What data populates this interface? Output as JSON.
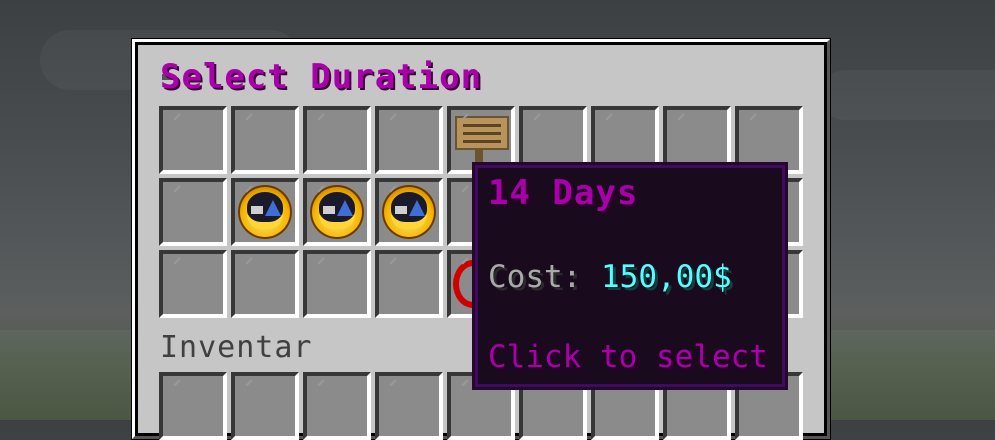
{
  "window": {
    "title": "Select Duration",
    "inventory_label": "Inventar"
  },
  "tooltip": {
    "title": "14 Days",
    "cost_label": "Cost:",
    "cost_value": "150,00$",
    "action": "Click to select"
  },
  "slots": {
    "rows": 4,
    "cols": 9,
    "items": [
      {
        "row": 0,
        "col": 4,
        "icon": "sign-icon"
      },
      {
        "row": 1,
        "col": 1,
        "icon": "clock-icon"
      },
      {
        "row": 1,
        "col": 2,
        "icon": "clock-icon"
      },
      {
        "row": 1,
        "col": 3,
        "icon": "clock-icon"
      },
      {
        "row": 2,
        "col": 4,
        "icon": "barrier-icon"
      }
    ]
  },
  "colors": {
    "title": "#aa00aa",
    "cost_value": "#55ffff",
    "cost_label": "#aaaaaa",
    "tooltip_bg": "#1a0a1e",
    "tooltip_border": "#3f0b5c"
  }
}
